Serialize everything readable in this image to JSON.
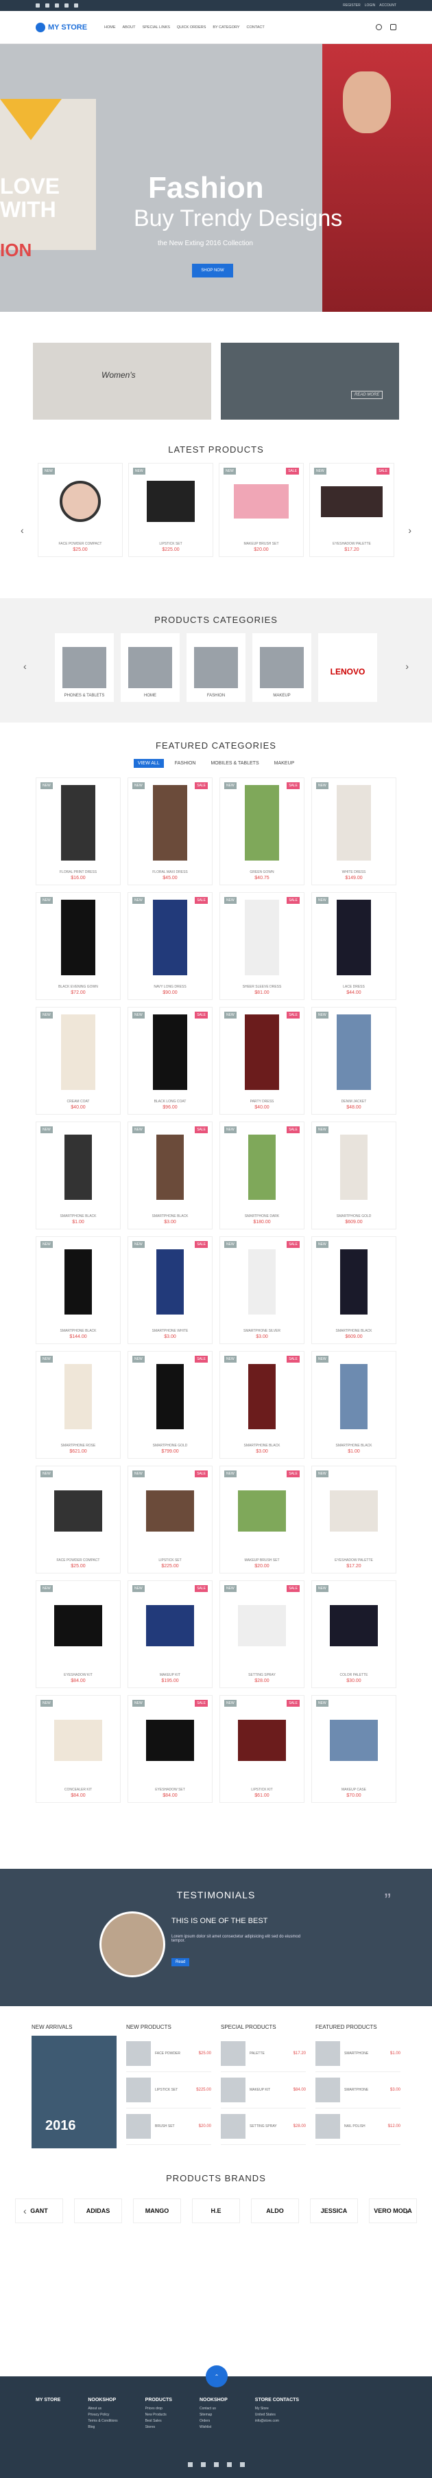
{
  "topbar": {
    "links": [
      "REGISTER",
      "LOGIN",
      "ACCOUNT"
    ]
  },
  "header": {
    "logo": "MY STORE",
    "nav": [
      "HOME",
      "ABOUT",
      "SPECIAL LINKS",
      "QUICK ORDERS",
      "BY CATEGORY",
      "CONTACT"
    ]
  },
  "hero": {
    "left_line1": "LOVE",
    "left_line2": "WITH",
    "left_line3": "ION",
    "title": "Fashion",
    "subtitle": "Buy Trendy Designs",
    "tagline": "the New Exting 2016 Collection",
    "button": "SHOP NOW"
  },
  "banners": [
    {
      "text": "Women's"
    },
    {
      "text": "READ MORE"
    }
  ],
  "latest": {
    "title": "LATEST PRODUCTS",
    "items": [
      {
        "name": "FACE POWDER COMPACT",
        "price": "$25.00",
        "tag": "NEW"
      },
      {
        "name": "LIPSTICK SET",
        "price": "$225.00",
        "tag": "NEW"
      },
      {
        "name": "MAKEUP BRUSH SET",
        "price": "$20.00",
        "tag": "NEW",
        "sale": "SALE"
      },
      {
        "name": "EYESHADOW PALETTE",
        "price": "$17.20",
        "tag": "NEW",
        "sale": "SALE"
      }
    ]
  },
  "categories": {
    "title": "PRODUCTS CATEGORIES",
    "items": [
      "PHONES & TABLETS",
      "HOME",
      "FASHION",
      "MAKEUP",
      "LENOVO"
    ]
  },
  "featured": {
    "title": "FEATURED CATEGORIES",
    "tabs": [
      "VIEW ALL",
      "FASHION",
      "MOBILES & TABLETS",
      "MAKEUP"
    ],
    "items": [
      {
        "name": "FLORAL PRINT DRESS",
        "price": "$16.00"
      },
      {
        "name": "FLORAL MAXI DRESS",
        "price": "$45.00"
      },
      {
        "name": "GREEN GOWN",
        "price": "$40.75"
      },
      {
        "name": "WHITE DRESS",
        "price": "$149.00"
      },
      {
        "name": "BLACK EVENING GOWN",
        "price": "$72.00"
      },
      {
        "name": "NAVY LONG DRESS",
        "price": "$90.00"
      },
      {
        "name": "SHEER SLEEVE DRESS",
        "price": "$81.00"
      },
      {
        "name": "LACE DRESS",
        "price": "$44.00"
      },
      {
        "name": "CREAM COAT",
        "price": "$40.00"
      },
      {
        "name": "BLACK LONG COAT",
        "price": "$96.00"
      },
      {
        "name": "PARTY DRESS",
        "price": "$40.00"
      },
      {
        "name": "DENIM JACKET",
        "price": "$48.00"
      },
      {
        "name": "SMARTPHONE BLACK",
        "price": "$1.00"
      },
      {
        "name": "SMARTPHONE BLACK",
        "price": "$3.00"
      },
      {
        "name": "SMARTPHONE DARK",
        "price": "$180.00"
      },
      {
        "name": "SMARTPHONE GOLD",
        "price": "$609.00"
      },
      {
        "name": "SMARTPHONE BLACK",
        "price": "$144.00"
      },
      {
        "name": "SMARTPHONE WHITE",
        "price": "$3.00"
      },
      {
        "name": "SMARTPHONE SILVER",
        "price": "$3.00"
      },
      {
        "name": "SMARTPHONE BLACK",
        "price": "$609.00"
      },
      {
        "name": "SMARTPHONE ROSE",
        "price": "$621.00"
      },
      {
        "name": "SMARTPHONE GOLD",
        "price": "$799.00"
      },
      {
        "name": "SMARTPHONE BLACK",
        "price": "$3.00"
      },
      {
        "name": "SMARTPHONE BLACK",
        "price": "$1.00"
      },
      {
        "name": "FACE POWDER COMPACT",
        "price": "$25.00"
      },
      {
        "name": "LIPSTICK SET",
        "price": "$225.00"
      },
      {
        "name": "MAKEUP BRUSH SET",
        "price": "$20.00"
      },
      {
        "name": "EYESHADOW PALETTE",
        "price": "$17.20"
      },
      {
        "name": "EYESHADOW KIT",
        "price": "$84.00"
      },
      {
        "name": "MAKEUP KIT",
        "price": "$195.00"
      },
      {
        "name": "SETTING SPRAY",
        "price": "$28.00"
      },
      {
        "name": "COLOR PALETTE",
        "price": "$30.00"
      },
      {
        "name": "CONCEALER KIT",
        "price": "$84.00"
      },
      {
        "name": "EYESHADOW SET",
        "price": "$84.00"
      },
      {
        "name": "LIPSTICK KIT",
        "price": "$61.00"
      },
      {
        "name": "MAKEUP CASE",
        "price": "$70.00"
      }
    ]
  },
  "testimonials": {
    "title": "TESTIMONIALS",
    "heading": "THIS IS ONE OF THE BEST",
    "text": "Lorem ipsum dolor sit amet consectetur adipisicing elit sed do eiusmod tempor.",
    "button": "Read"
  },
  "columns": [
    {
      "title": "NEW ARRIVALS",
      "year": "2016"
    },
    {
      "title": "NEW PRODUCTS",
      "items": [
        {
          "name": "FACE POWDER",
          "price": "$25.00"
        },
        {
          "name": "LIPSTICK SET",
          "price": "$225.00"
        },
        {
          "name": "BRUSH SET",
          "price": "$20.00"
        }
      ]
    },
    {
      "title": "SPECIAL PRODUCTS",
      "items": [
        {
          "name": "PALETTE",
          "price": "$17.20"
        },
        {
          "name": "MAKEUP KIT",
          "price": "$84.00"
        },
        {
          "name": "SETTING SPRAY",
          "price": "$28.00"
        }
      ]
    },
    {
      "title": "FEATURED PRODUCTS",
      "items": [
        {
          "name": "SMARTPHONE",
          "price": "$1.00"
        },
        {
          "name": "SMARTPHONE",
          "price": "$3.00"
        },
        {
          "name": "NAIL POLISH",
          "price": "$12.00"
        }
      ]
    }
  ],
  "brands": {
    "title": "PRODUCTS BRANDS",
    "items": [
      "GANT",
      "ADIDAS",
      "MANGO",
      "H.E",
      "ALDO",
      "JESSICA",
      "VERO MODA"
    ]
  },
  "footer": {
    "logo": "MY STORE",
    "cols": [
      {
        "title": "NOOKSHOP",
        "lines": [
          "About us",
          "Privacy Policy",
          "Terms & Conditions",
          "Blog"
        ]
      },
      {
        "title": "PRODUCTS",
        "lines": [
          "Prices drop",
          "New Products",
          "Best Sales",
          "Stores"
        ]
      },
      {
        "title": "NOOKSHOP",
        "lines": [
          "Contact us",
          "Sitemap",
          "Orders",
          "Wishlist"
        ]
      },
      {
        "title": "STORE CONTACTS",
        "lines": [
          "My Store",
          "United States",
          "info@store.com"
        ]
      }
    ]
  }
}
